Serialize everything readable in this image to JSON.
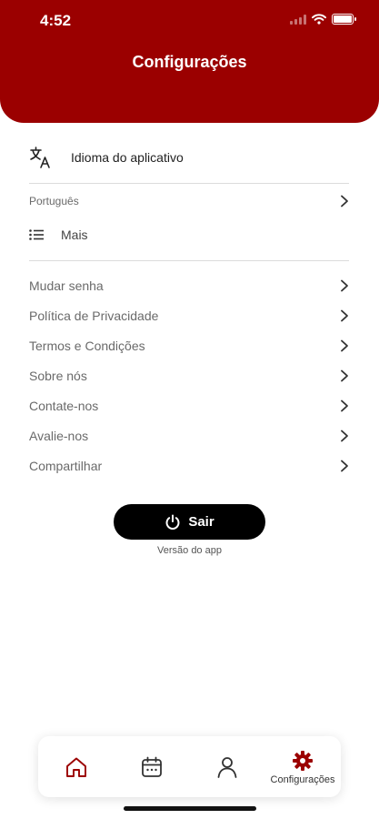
{
  "status_bar": {
    "time": "4:52"
  },
  "header": {
    "title": "Configurações"
  },
  "language": {
    "section_label": "Idioma do aplicativo",
    "current_value": "Português"
  },
  "more": {
    "label": "Mais"
  },
  "menu": {
    "items": [
      {
        "label": "Mudar senha"
      },
      {
        "label": "Política de Privacidade"
      },
      {
        "label": "Termos e Condições"
      },
      {
        "label": "Sobre nós"
      },
      {
        "label": "Contate-nos"
      },
      {
        "label": "Avalie-nos"
      },
      {
        "label": "Compartilhar"
      }
    ]
  },
  "logout": {
    "label": "Sair"
  },
  "version": {
    "label": "Versão do app"
  },
  "tabbar": {
    "tabs": [
      {
        "icon": "home-icon"
      },
      {
        "icon": "calendar-icon"
      },
      {
        "icon": "profile-icon"
      },
      {
        "icon": "gear-icon",
        "label": "Configurações"
      }
    ]
  },
  "colors": {
    "brand": "#9b0000",
    "button": "#000000"
  }
}
